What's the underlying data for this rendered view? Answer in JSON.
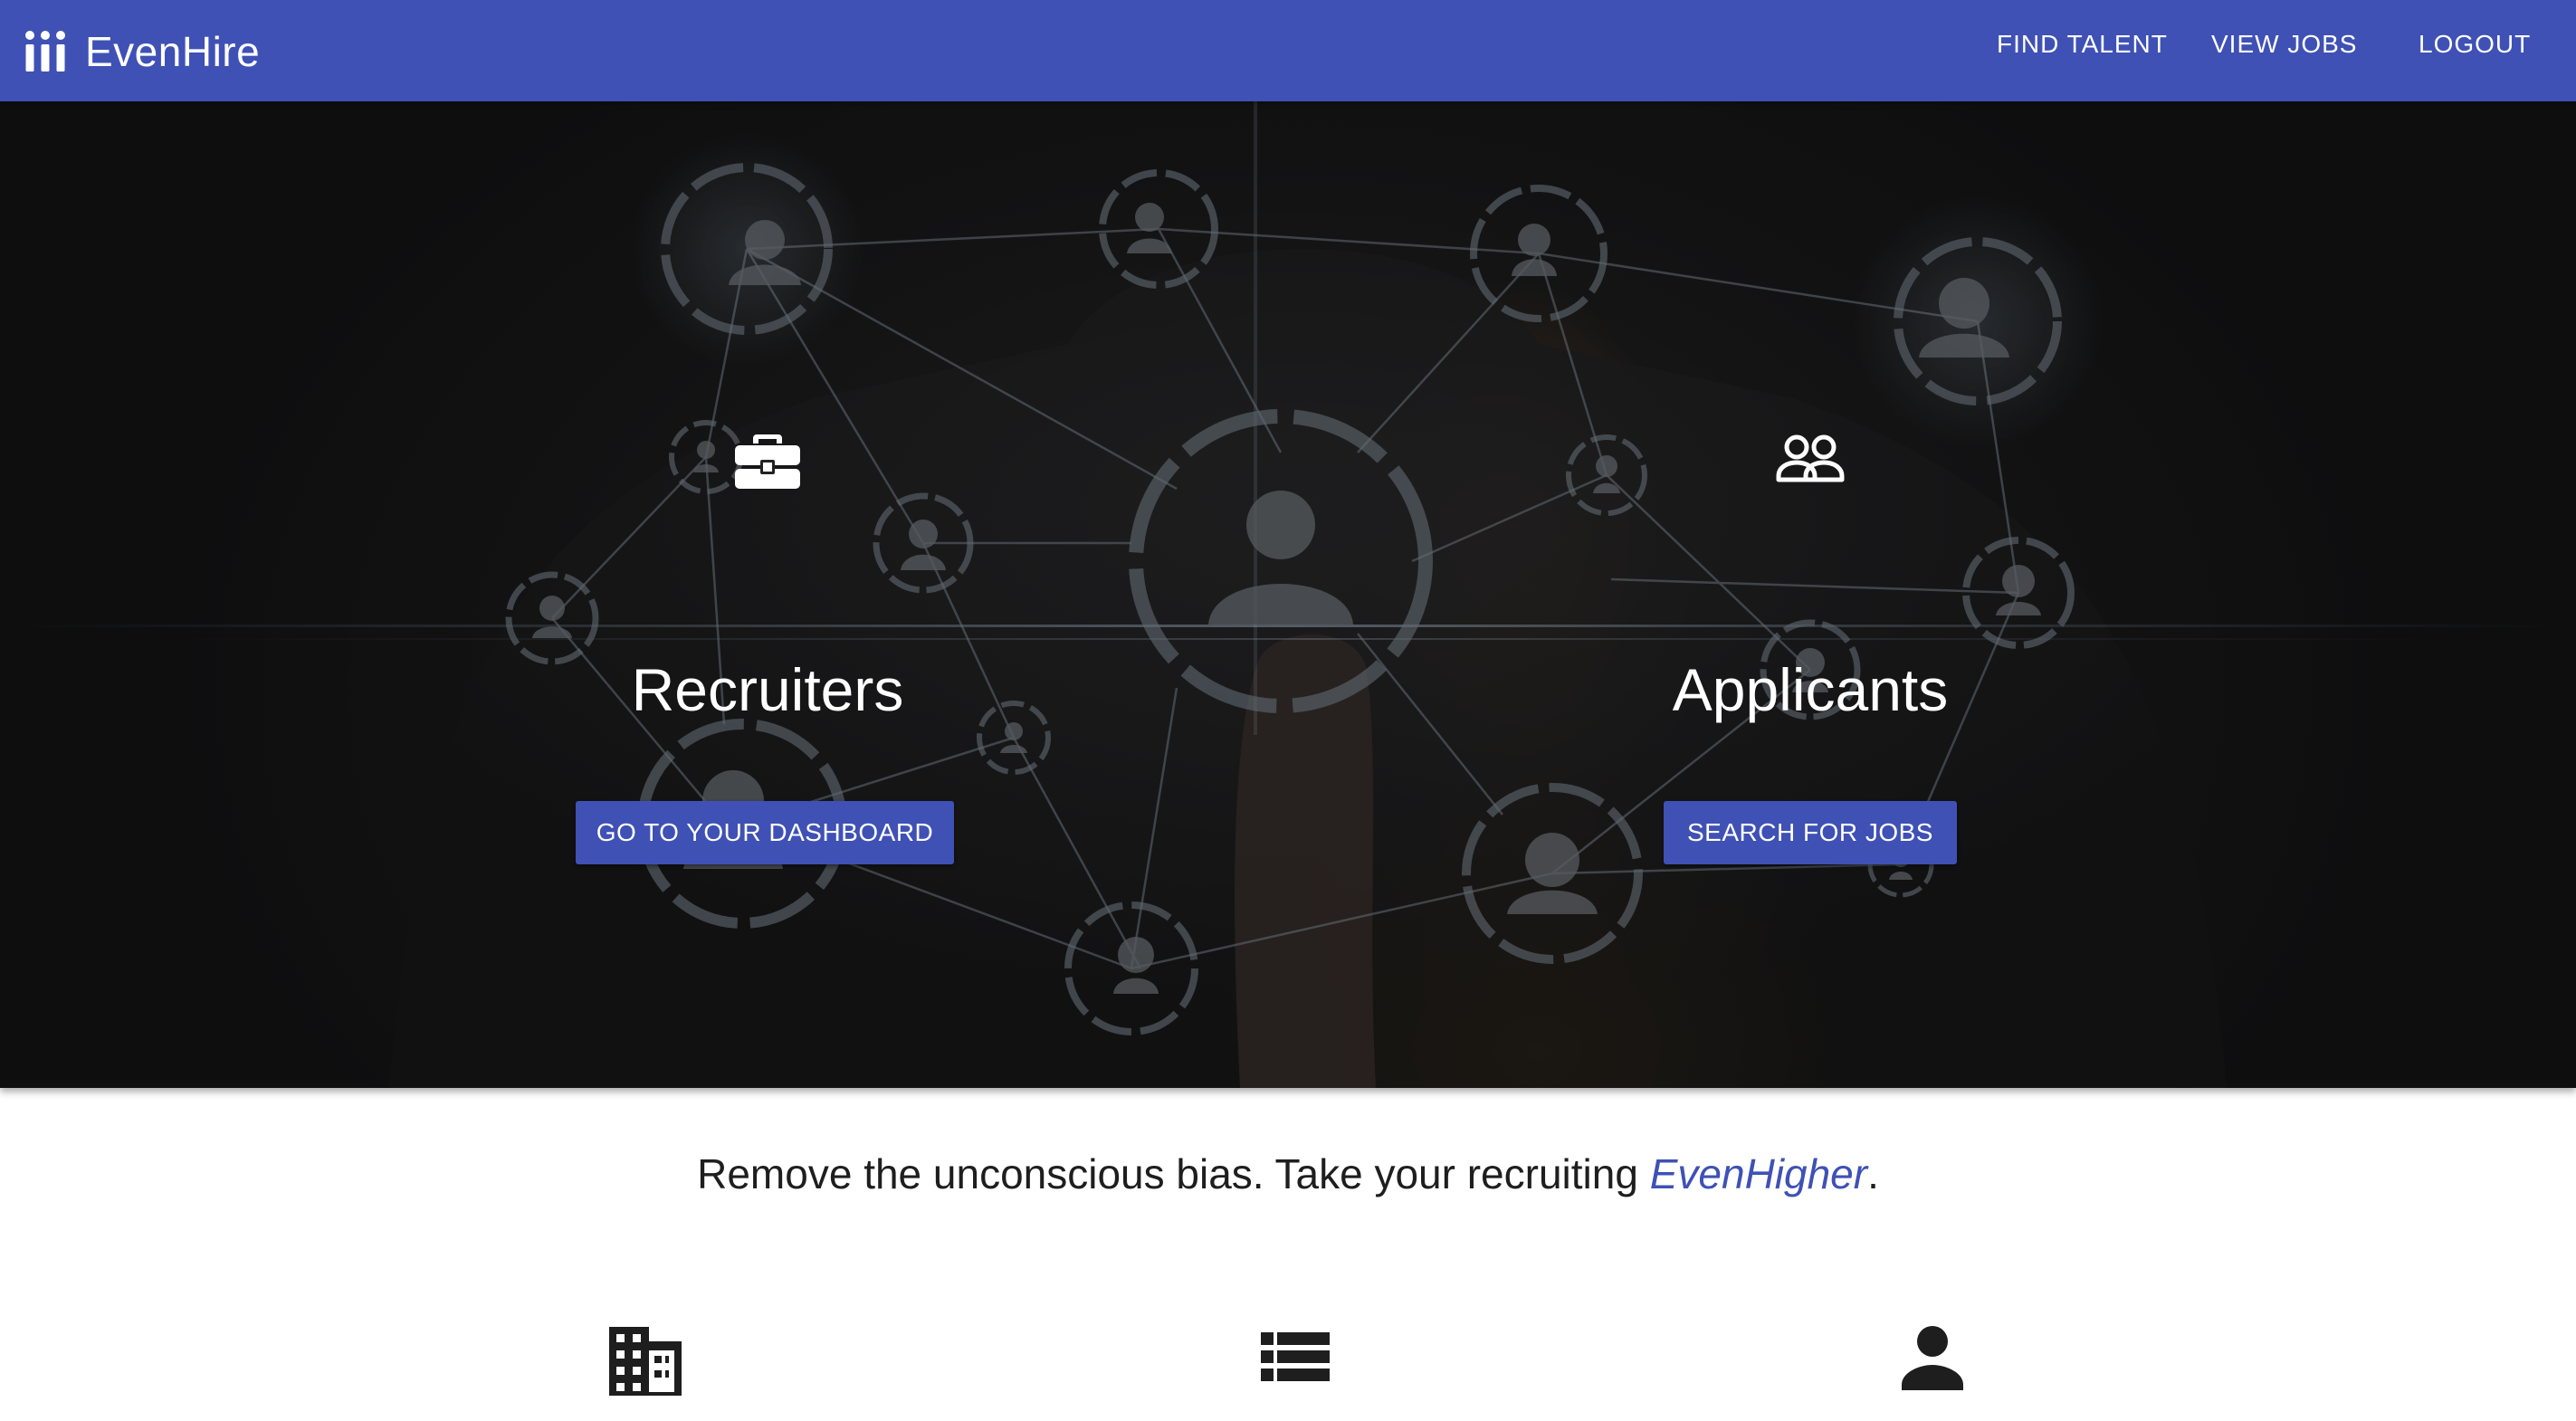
{
  "navbar": {
    "brand_name": "EvenHire",
    "brand_icon": "three-people-logo-icon",
    "links": {
      "find_talent": "FIND TALENT",
      "view_jobs": "VIEW JOBS",
      "logout": "LOGOUT"
    }
  },
  "hero": {
    "recruiters": {
      "icon": "briefcase-icon",
      "title": "Recruiters",
      "button_label": "GO TO YOUR DASHBOARD"
    },
    "applicants": {
      "icon": "people-outline-icon",
      "title": "Applicants",
      "button_label": "SEARCH FOR JOBS"
    }
  },
  "tagline": {
    "text": "Remove the unconscious bias. Take your recruiting ",
    "highlight": "EvenHigher",
    "end": "."
  },
  "features": [
    {
      "icon": "building-icon"
    },
    {
      "icon": "list-icon"
    },
    {
      "icon": "person-icon"
    }
  ],
  "colors": {
    "primary": "#3f51b5",
    "text_dark": "#1e1e1e",
    "white": "#ffffff"
  }
}
